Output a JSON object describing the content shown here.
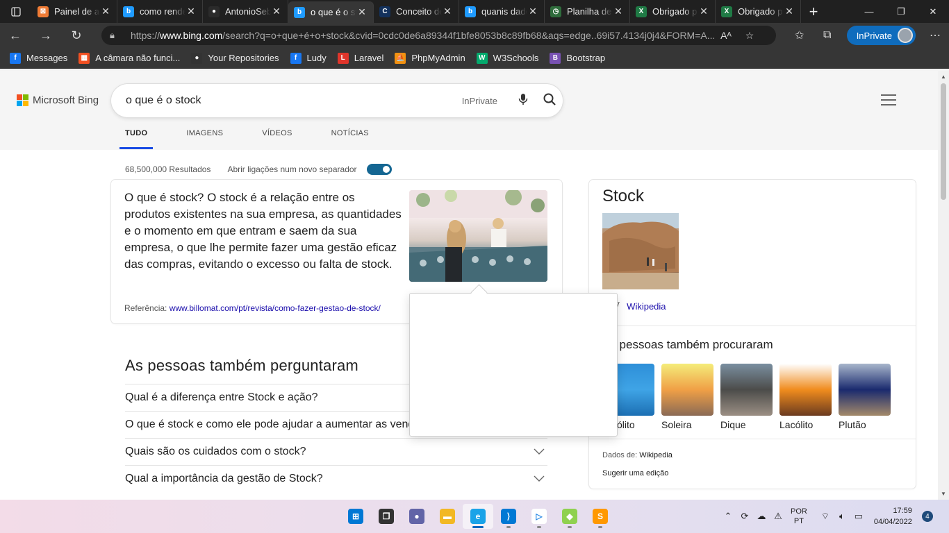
{
  "browser": {
    "tabs": [
      {
        "title": "Painel de ad",
        "icon": "xampp-icon",
        "color": "#f07c36",
        "glyph": "⊠"
      },
      {
        "title": "como render",
        "icon": "bing-icon",
        "color": "#1f9bff",
        "glyph": "b"
      },
      {
        "title": "AntonioSeba",
        "icon": "github-icon",
        "color": "#2b2b2b",
        "glyph": "●"
      },
      {
        "title": "o que é o st",
        "icon": "bing-icon",
        "color": "#1f9bff",
        "glyph": "b",
        "active": true
      },
      {
        "title": "Conceito de",
        "icon": "conceito-icon",
        "color": "#13315c",
        "glyph": "C"
      },
      {
        "title": "quanis dado",
        "icon": "bing-icon",
        "color": "#1f9bff",
        "glyph": "b"
      },
      {
        "title": "Planilha de",
        "icon": "planilha-icon",
        "color": "#2f6c3c",
        "glyph": "◷"
      },
      {
        "title": "Obrigado p",
        "icon": "excel-icon",
        "color": "#1f7a45",
        "glyph": "X"
      },
      {
        "title": "Obrigado p",
        "icon": "excel-icon",
        "color": "#1f7a45",
        "glyph": "X"
      }
    ],
    "url_prefix": "https://",
    "url_host": "www.bing.com",
    "url_rest": "/search?q=o+que+é+o+stock&cvid=0cdc0de6a89344f1bfe8053b8c89fb68&aqs=edge..69i57.4134j0j4&FORM=A...",
    "inprivate_label": "InPrivate",
    "favorites": [
      {
        "label": "Messages",
        "icon": "facebook-icon",
        "color": "#1877f2",
        "glyph": "f"
      },
      {
        "label": "A câmara não funci...",
        "icon": "microsoft-icon",
        "color": "#f25022",
        "glyph": "▦"
      },
      {
        "label": "Your Repositories",
        "icon": "github-icon",
        "color": "#333333",
        "glyph": "●"
      },
      {
        "label": "Ludy",
        "icon": "facebook-icon",
        "color": "#1877f2",
        "glyph": "f"
      },
      {
        "label": "Laravel",
        "icon": "laravel-icon",
        "color": "#e0352b",
        "glyph": "L"
      },
      {
        "label": "PhpMyAdmin",
        "icon": "phpmyadmin-icon",
        "color": "#f29111",
        "glyph": "⛵"
      },
      {
        "label": "W3Schools",
        "icon": "w3schools-icon",
        "color": "#04aa6d",
        "glyph": "W"
      },
      {
        "label": "Bootstrap",
        "icon": "bootstrap-icon",
        "color": "#7952b3",
        "glyph": "B"
      }
    ]
  },
  "bing": {
    "brand": "Microsoft Bing",
    "query": "o que é o stock",
    "inprivate_label": "InPrivate",
    "scopes": [
      "TUDO",
      "IMAGENS",
      "VÍDEOS",
      "NOTÍCIAS"
    ],
    "results_count": "68,500,000 Resultados",
    "new_tab_label": "Abrir ligações num novo separador",
    "answer": {
      "text": "O que é stock? O stock é a relação entre os produtos existentes na sua empresa, as quantidades e o momento em que entram e saem da sua empresa, o que lhe permite fazer uma gestão eficaz das compras, evitando o excesso ou falta de stock.",
      "ref_label": "Referência:",
      "ref_link": "www.billomat.com/pt/revista/como-fazer-gestao-de-stock/"
    },
    "paa": {
      "title": "As pessoas também perguntaram",
      "items": [
        "Qual é a diferença entre Stock e ação?",
        "O que é stock e como ele pode ajudar a aumentar as vendas?",
        "Quais são os cuidados com o stock?",
        "Qual a importância da gestão de Stock?"
      ]
    },
    "knowledge": {
      "title": "Stock",
      "source": "Wikipedia",
      "also_title": "As pessoas também procuraram",
      "related": [
        {
          "label": "Batólito",
          "colors": [
            "#2e8fd8",
            "#3fa4e6",
            "#1c6fb3"
          ]
        },
        {
          "label": "Soleira",
          "colors": [
            "#f4ec7a",
            "#f0a046",
            "#8a6a55"
          ]
        },
        {
          "label": "Dique",
          "colors": [
            "#7a8fa0",
            "#4c4c4a",
            "#9b8f84"
          ]
        },
        {
          "label": "Lacólito",
          "colors": [
            "#ffffff",
            "#f08c1e",
            "#6b3b1f"
          ]
        },
        {
          "label": "Plutão",
          "colors": [
            "#a8b6cb",
            "#1a2a6e",
            "#a48a6a"
          ]
        }
      ],
      "data_from_label": "Dados de:",
      "data_from_value": "Wikipedia",
      "suggest_edit": "Sugerir uma edição"
    }
  },
  "taskbar": {
    "apps": [
      {
        "name": "start-icon",
        "color": "#0078d4",
        "glyph": "⊞"
      },
      {
        "name": "task-view-icon",
        "color": "#333333",
        "glyph": "❐"
      },
      {
        "name": "teams-chat-icon",
        "color": "#6264a7",
        "glyph": "●"
      },
      {
        "name": "file-explorer-icon",
        "color": "#f2b824",
        "glyph": "▬"
      },
      {
        "name": "edge-icon",
        "color": "#1aa3e8",
        "glyph": "e",
        "active": true
      },
      {
        "name": "vscode-icon",
        "color": "#0078d4",
        "glyph": "⟩"
      },
      {
        "name": "media-player-icon",
        "color": "#ffffff",
        "glyph": "▷"
      },
      {
        "name": "gitkraken-icon",
        "color": "#8fd14f",
        "glyph": "◆"
      },
      {
        "name": "sublime-text-icon",
        "color": "#ff9800",
        "glyph": "S"
      }
    ],
    "lang_top": "POR",
    "lang_bottom": "PT",
    "time": "17:59",
    "date": "04/04/2022",
    "notifications": "4"
  }
}
